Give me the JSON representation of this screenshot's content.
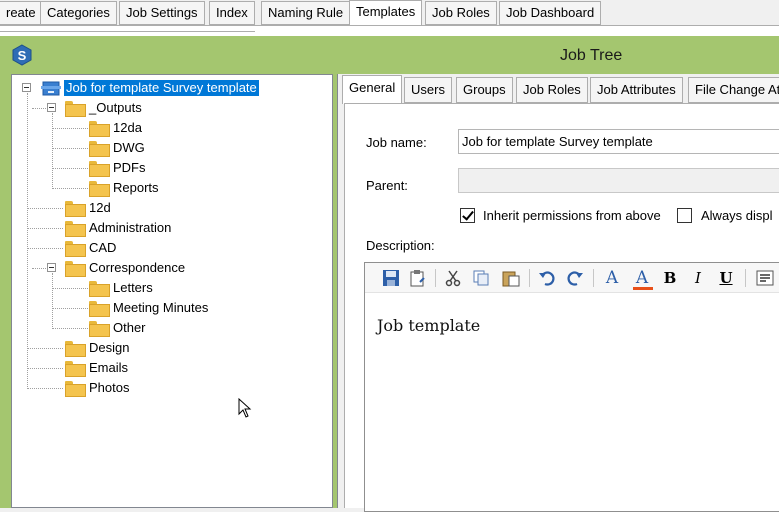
{
  "top_tabs": [
    "reate",
    "Categories",
    "Job Settings",
    "Index",
    "Naming Rule",
    "Templates",
    "Job Roles",
    "Job Dashboard"
  ],
  "active_top_tab": "Templates",
  "window": {
    "title": "Job Tree",
    "accent": "#a4c66f"
  },
  "tree": {
    "root": "Job for template Survey template",
    "outputs": "_Outputs",
    "outputs_children": [
      "12da",
      "DWG",
      "PDFs",
      "Reports"
    ],
    "mid": [
      "12d",
      "Administration",
      "CAD"
    ],
    "correspondence": "Correspondence",
    "correspondence_children": [
      "Letters",
      "Meeting Minutes",
      "Other"
    ],
    "tail": [
      "Design",
      "Emails",
      "Photos"
    ]
  },
  "inner_tabs": [
    "General",
    "Users",
    "Groups",
    "Job Roles",
    "Job Attributes",
    "File Change At"
  ],
  "form": {
    "job_name_label": "Job name:",
    "job_name_value": "Job for template Survey template",
    "parent_label": "Parent:",
    "parent_value": "",
    "inherit_label": "Inherit permissions from above",
    "inherit_checked": true,
    "always_label": "Always displ",
    "always_checked": false,
    "description_label": "Description:"
  },
  "editor": {
    "toolbar_icons": [
      "save-icon",
      "paste-icon",
      "cut-icon",
      "copy-icon",
      "paste-special-icon",
      "undo-icon",
      "redo-icon",
      "font-icon",
      "font-color-icon",
      "bold-icon",
      "italic-icon",
      "underline-icon",
      "align-icon"
    ],
    "letters": {
      "font": "A",
      "font_color": "A",
      "bold": "B",
      "italic": "I",
      "underline": "U"
    },
    "body": "Job template"
  }
}
